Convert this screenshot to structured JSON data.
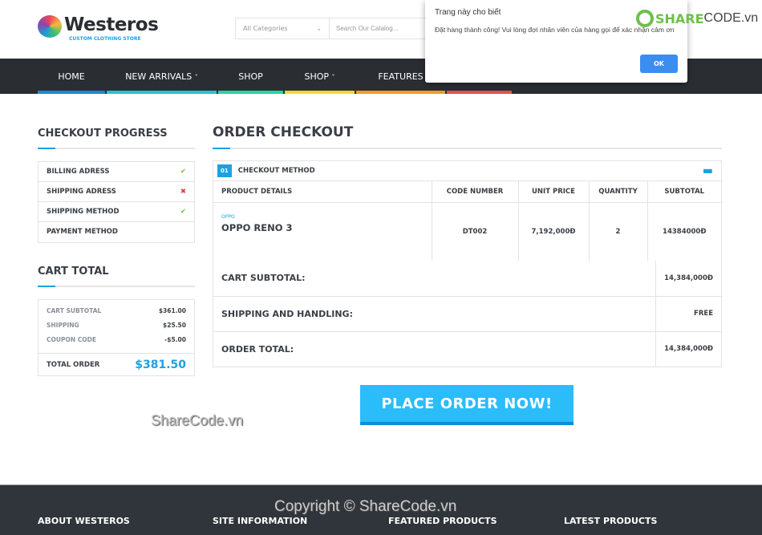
{
  "brand": {
    "name": "Westeros",
    "tagline": "CUSTOM CLOTHING STORE"
  },
  "search": {
    "category": "All Categories",
    "placeholder": "Search Our Catalog..."
  },
  "nav": [
    {
      "label": "HOME",
      "color": "#1e88d0"
    },
    {
      "label": "NEW ARRIVALS",
      "color": "#2bc0d8",
      "dropdown": true
    },
    {
      "label": "SHOP",
      "color": "#2bd3a0"
    },
    {
      "label": "SHOP",
      "color": "#f5d33a",
      "dropdown": true
    },
    {
      "label": "FEATURES",
      "color": "#f39a2b"
    },
    {
      "label": "",
      "color": "#e0524f"
    }
  ],
  "progress": {
    "title": "CHECKOUT PROGRESS",
    "steps": [
      {
        "label": "BILLING ADRESS",
        "status": "done"
      },
      {
        "label": "SHIPPING ADRESS",
        "status": "error"
      },
      {
        "label": "SHIPPING METHOD",
        "status": "done"
      },
      {
        "label": "PAYMENT METHOD",
        "status": ""
      }
    ]
  },
  "cart": {
    "title": "CART TOTAL",
    "rows": [
      {
        "label": "CART SUBTOTAL",
        "value": "$361.00"
      },
      {
        "label": "SHIPPING",
        "value": "$25.50"
      },
      {
        "label": "COUPON CODE",
        "value": "-$5.00"
      }
    ],
    "total_label": "TOTAL ORDER",
    "total_value": "$381.50"
  },
  "checkout": {
    "title": "ORDER CHECKOUT",
    "step_num": "01",
    "step_label": "CHECKOUT METHOD",
    "columns": [
      "PRODUCT DETAILS",
      "CODE NUMBER",
      "UNIT PRICE",
      "QUANTITY",
      "SUBTOTAL"
    ],
    "item": {
      "brand": "OPPO",
      "name": "OPPO RENO 3",
      "code": "DT002",
      "unit_price": "7,192,000Đ",
      "quantity": "2",
      "subtotal": "14384000Đ"
    },
    "summary": [
      {
        "label": "CART SUBTOTAL:",
        "value": "14,384,000Đ"
      },
      {
        "label": "SHIPPING AND HANDLING:",
        "value": "FREE"
      },
      {
        "label": "ORDER TOTAL:",
        "value": "14,384,000Đ"
      }
    ],
    "place_order": "PLACE ORDER NOW!"
  },
  "footer": {
    "headings": [
      "ABOUT WESTEROS",
      "SITE INFORMATION",
      "FEATURED PRODUCTS",
      "LATEST PRODUCTS"
    ]
  },
  "watermark": {
    "text": "ShareCode.vn",
    "copyright": "Copyright © ShareCode.vn",
    "logo_share": "SHARE",
    "logo_code": "CODE.vn"
  },
  "dialog": {
    "title": "Trang này cho biết",
    "message": "Đặt hàng thành công! Vui lòng đợi nhân viên của hàng gọi để xác nhận cảm ơn",
    "ok": "OK"
  }
}
